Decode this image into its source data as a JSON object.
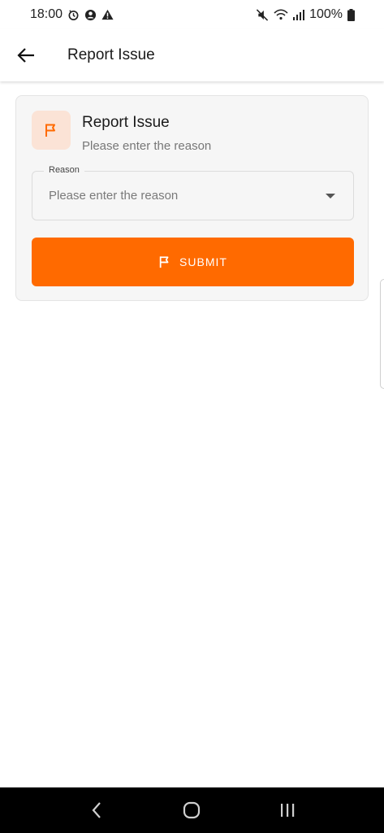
{
  "status_bar": {
    "time": "18:00",
    "battery": "100%"
  },
  "app_bar": {
    "title": "Report Issue"
  },
  "card": {
    "title": "Report Issue",
    "subtitle": "Please enter the reason",
    "reason_label": "Reason",
    "reason_placeholder": "Please enter the reason",
    "submit_label": "SUBMIT"
  },
  "colors": {
    "accent": "#ff6a00",
    "flag_tile_bg": "#fbe3d6"
  },
  "icons": {
    "back": "arrow-left-icon",
    "flag": "flag-icon",
    "dropdown": "caret-down-icon"
  }
}
